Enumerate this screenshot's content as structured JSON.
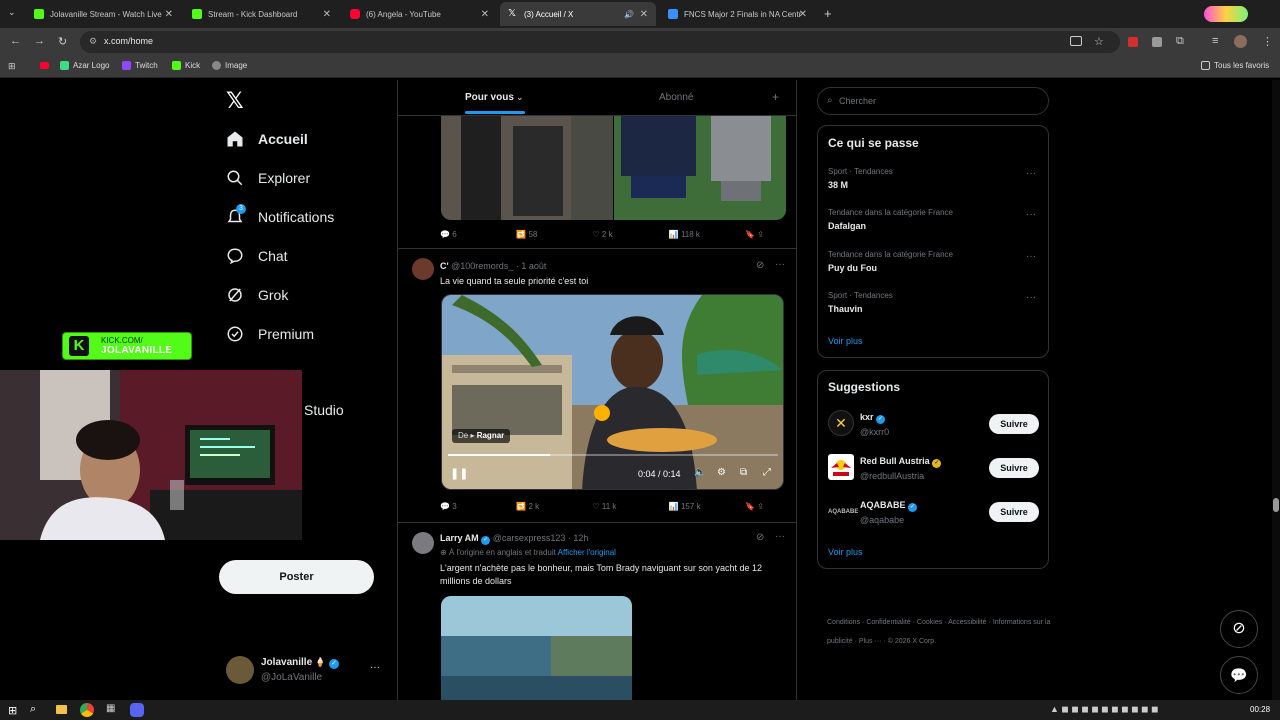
{
  "browser": {
    "tabs": [
      {
        "label": "Jolavanille Stream - Watch Live",
        "color": "#53fc18"
      },
      {
        "label": "Stream - Kick Dashboard",
        "color": "#53fc18"
      },
      {
        "label": "(6) Angela - YouTube",
        "color": "#ff0033"
      },
      {
        "label": "(3) Accueil / X",
        "color": "#ffffff"
      },
      {
        "label": "FNCS Major 2 Finals in NA Centr",
        "color": "#3a8fff"
      }
    ],
    "url": "x.com/home",
    "bookmarks": [
      "Azar Logo",
      "Twitch",
      "Kick",
      "Image"
    ],
    "all_bookmarks": "Tous les favoris"
  },
  "nav": {
    "items": [
      {
        "label": "Accueil",
        "icon": "home-icon"
      },
      {
        "label": "Explorer",
        "icon": "search-icon"
      },
      {
        "label": "Notifications",
        "icon": "bell-icon",
        "badge": "3"
      },
      {
        "label": "Chat",
        "icon": "chat-icon"
      },
      {
        "label": "Grok",
        "icon": "grok-icon"
      },
      {
        "label": "Premium",
        "icon": "premium-icon"
      },
      {
        "label": "Studio",
        "icon": "studio-icon"
      }
    ],
    "post_button": "Poster",
    "account": {
      "name": "Jolavanille",
      "handle": "@JoLaVanille",
      "emoji": "🍦"
    }
  },
  "overlay": {
    "kick_line1": "KICK.COM/",
    "kick_line2": "JOLAVANILLE"
  },
  "feed": {
    "tabs": [
      "Pour vous",
      "Abonné"
    ],
    "tweet1_actions": {
      "replies": "6",
      "retweets": "58",
      "likes": "2 k",
      "views": "118 k"
    },
    "tweet2": {
      "name": "C'",
      "handle": "@100remords_",
      "date": "· 1 août",
      "text": "La vie quand ta seule priorité c'est toi",
      "video_caption_prefix": "De",
      "video_caption_name": "Ragnar",
      "time": "0:04 / 0:14",
      "actions": {
        "replies": "3",
        "retweets": "2 k",
        "likes": "11 k",
        "views": "157 k"
      }
    },
    "tweet3": {
      "name": "Larry AM",
      "handle": "@carsexpress123",
      "date": "· 12h",
      "translated": "À l'origine en anglais et traduit",
      "show_original": "Afficher l'original",
      "text": "L'argent n'achète pas le bonheur, mais Tom Brady naviguant sur son yacht de 12 millions de dollars"
    }
  },
  "sidebar": {
    "search_placeholder": "Chercher",
    "trends_title": "Ce qui se passe",
    "trends": [
      {
        "category": "Sport · Tendances",
        "name": "38 M"
      },
      {
        "category": "Tendance dans la catégorie France",
        "name": "Dafalgan"
      },
      {
        "category": "Tendance dans la catégorie France",
        "name": "Puy du Fou"
      },
      {
        "category": "Sport · Tendances",
        "name": "Thauvin"
      }
    ],
    "see_more": "Voir plus",
    "suggestions_title": "Suggestions",
    "suggestions": [
      {
        "name": "kxr",
        "handle": "@kxrr0"
      },
      {
        "name": "Red Bull Austria",
        "handle": "@redbullAustria"
      },
      {
        "name": "AQABABE",
        "handle": "@aqababe"
      }
    ],
    "follow_label": "Suivre",
    "footer": [
      "Conditions",
      "Confidentialité",
      "Cookies",
      "Accessibilité",
      "Informations sur la publicité",
      "Plus ···",
      "© 2026 X Corp."
    ]
  },
  "taskbar": {
    "time": "00:28"
  }
}
